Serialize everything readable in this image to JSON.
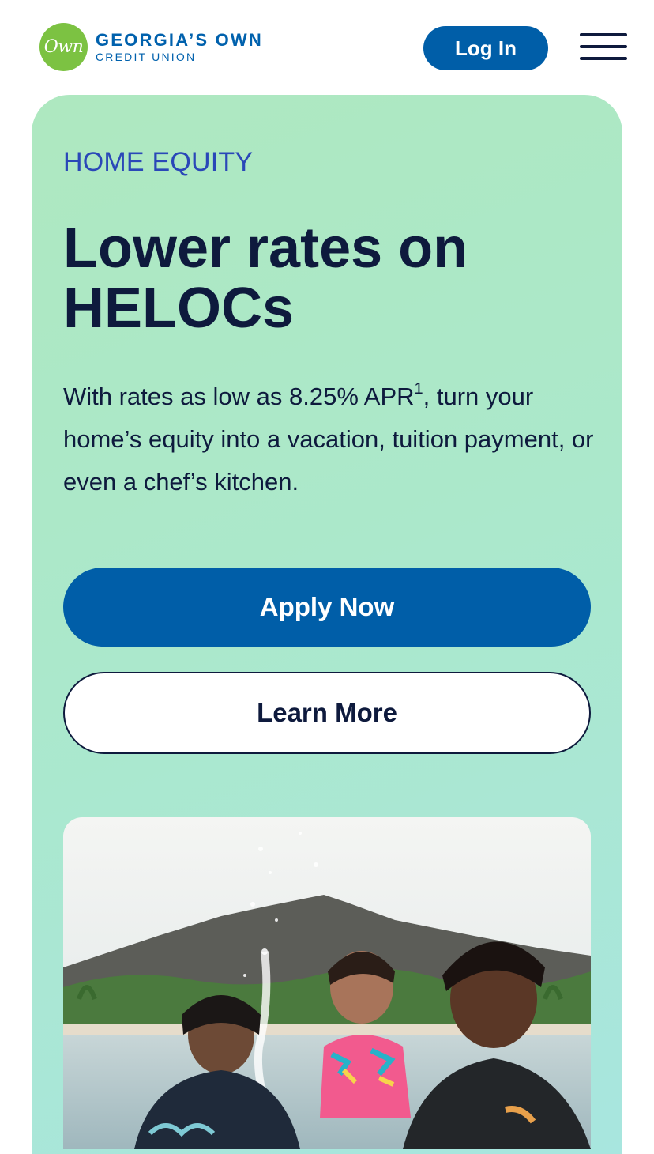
{
  "header": {
    "logo_badge": "Own",
    "logo_line1": "GEORGIA’S OWN",
    "logo_line2": "CREDIT UNION",
    "login_label": "Log In",
    "menu_icon": "hamburger-menu-icon"
  },
  "hero": {
    "eyebrow": "HOME EQUITY",
    "headline": "Lower rates on HELOCs",
    "body_before": "With rates as low as 8.25% APR",
    "body_footnote": "1",
    "body_after": ", turn your home’s equity into a vacation, tuition payment, or even a chef’s kitchen.",
    "apply_label": "Apply Now",
    "learn_label": "Learn More"
  },
  "colors": {
    "brand_blue": "#005ea8",
    "navy": "#0e1a3d",
    "logo_green": "#7cc242",
    "eyebrow_blue": "#2a47b8",
    "hero_bg": "#abe8cb"
  }
}
